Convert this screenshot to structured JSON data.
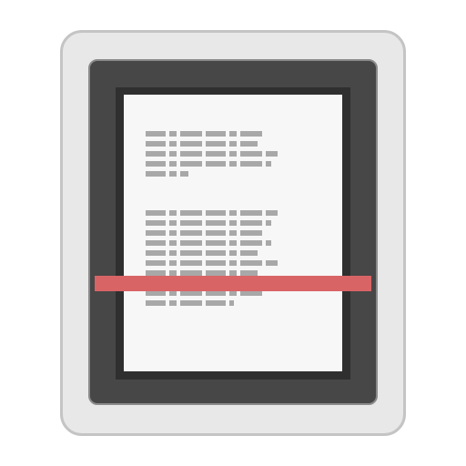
{
  "icon": {
    "name": "document-scanner",
    "colors": {
      "body": "#e8e8e8",
      "body_border": "#c4c4c4",
      "bed": "#474747",
      "glass_frame": "#2f2f2f",
      "paper": "#f7f7f7",
      "text_lines": "#a8a8a8",
      "scan_beam": "#d96465"
    },
    "paragraphs": [
      {
        "lines": [
          0.7,
          0.66,
          0.78,
          0.74,
          0.25
        ]
      },
      {
        "lines": [
          0.78,
          0.74,
          0.7,
          0.74,
          0.66,
          0.78,
          0.66,
          0.7,
          0.7,
          0.52
        ]
      }
    ]
  }
}
